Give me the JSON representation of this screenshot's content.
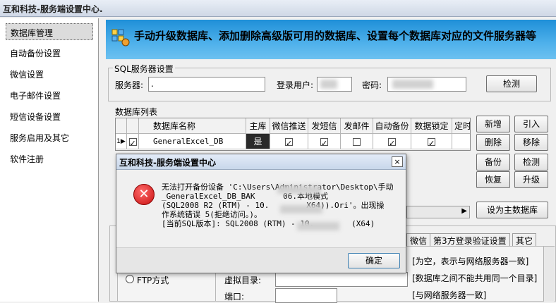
{
  "window": {
    "title": "互和科技-服务端设置中心."
  },
  "sidebar": {
    "items": [
      {
        "label": "数据库管理"
      },
      {
        "label": "自动备份设置"
      },
      {
        "label": "微信设置"
      },
      {
        "label": "电子邮件设置"
      },
      {
        "label": "短信设备设置"
      },
      {
        "label": "服务启用及其它"
      },
      {
        "label": "软件注册"
      }
    ]
  },
  "banner": {
    "text": "手动升级数据库、添加删除高级版可用的数据库、设置每个数据库对应的文件服务器等"
  },
  "sql_group": {
    "title": "SQL服务器设置",
    "server_label": "服务器:",
    "server_value": ".",
    "user_label": "登录用户:",
    "password_label": "密码:",
    "detect_button": "检测"
  },
  "db_list": {
    "title": "数据库列表",
    "columns": [
      "数据库名称",
      "主库",
      "微信推送",
      "发短信",
      "发邮件",
      "自动备份",
      "数据锁定",
      "定时"
    ],
    "rows": [
      {
        "index": "1",
        "arrow": "▶",
        "name": "GeneralExcel_DB",
        "main": "是",
        "checks": [
          true,
          true,
          false,
          true,
          true
        ]
      }
    ],
    "buttons": {
      "add": "新增",
      "import": "引入",
      "delete": "删除",
      "remove": "移除",
      "backup": "备份",
      "check": "检测",
      "restore": "恢复",
      "upgrade": "升级",
      "set_main": "设为主数据库"
    }
  },
  "bottom": {
    "tabs": [
      "微信",
      "第3方登录验证设置",
      "其它"
    ],
    "ftp_label": "FTP方式",
    "vdir_label": "虚拟目录:",
    "port_label": "端口:",
    "notes": [
      "[为空，表示与网络服务器一致]",
      "[数据库之间不能共用同一个目录]",
      "[与网络服务器一致]"
    ]
  },
  "dialog": {
    "title": "互和科技-服务端设置中心",
    "close": "×",
    "error_icon": "error-icon",
    "message": "无法打开备份设备 'C:\\Users\\Administrator\\Desktop\\手动\n_GeneralExcel_DB_BAK      06.本地模式\n(SQL2008 R2 (RTM) - 10.        X64)).Ori'。出现操\n作系统错误 5(拒绝访问。)。\n[当前SQL版本]: SQL2008 (RTM) - 10.        (X64)",
    "ok_button": "确定"
  },
  "colors": {
    "banner_top": "#1f8fd8",
    "banner_bottom": "#6dc1f0",
    "error_red": "#c81010"
  }
}
